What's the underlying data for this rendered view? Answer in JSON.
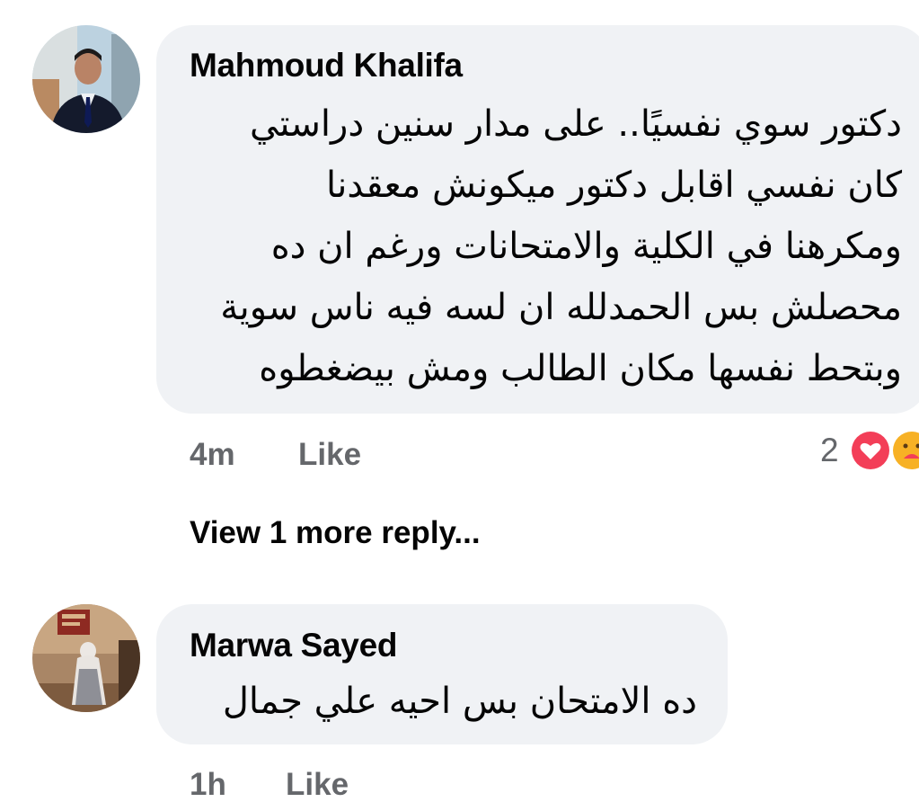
{
  "comments": [
    {
      "author": "Mahmoud Khalifa",
      "lines": [
        "دكتور سوي نفسيًا.. على مدار سنين دراستي",
        "كان نفسي اقابل دكتور ميكونش معقدنا",
        "ومكرهنا في الكلية والامتحانات ورغم ان ده",
        "محصلش بس الحمدلله ان لسه فيه ناس سوية",
        "وبتحط نفسها مكان الطالب ومش بيضغطوه"
      ],
      "time": "4m",
      "like_label": "Like",
      "reaction_count": "2",
      "reactions": [
        "heart-icon",
        "care-icon"
      ],
      "reaction_colors": {
        "heart": "#f33e58",
        "care": "#f7b125"
      }
    },
    {
      "author": "Marwa Sayed",
      "lines": [
        "ده الامتحان بس احيه علي جمال"
      ],
      "time": "1h",
      "like_label": "Like"
    }
  ],
  "view_more_label": "View 1 more reply...",
  "colors": {
    "bubble": "#f0f2f5",
    "meta": "#65676b",
    "text": "#050505"
  }
}
